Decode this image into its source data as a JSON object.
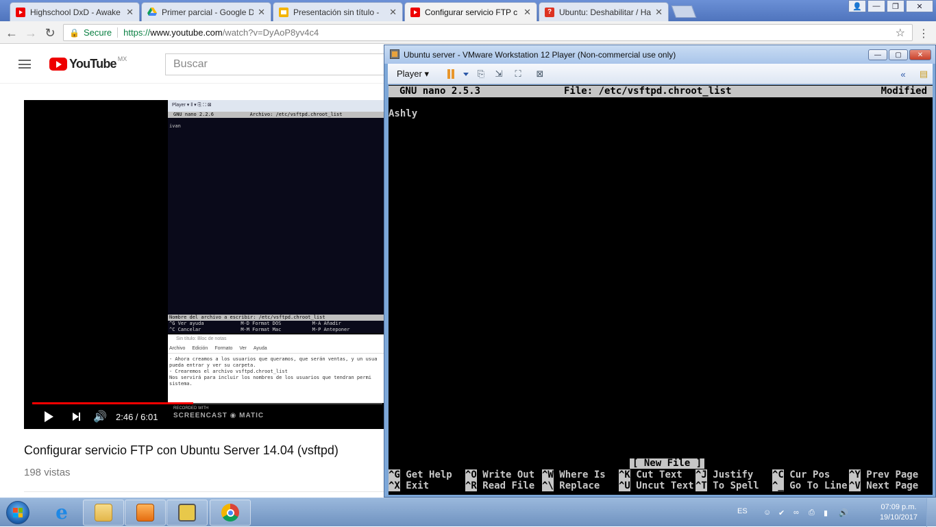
{
  "browser": {
    "tabs": [
      {
        "label": "Highschool DxD - Awake",
        "icon": "youtube-icon"
      },
      {
        "label": "Primer parcial - Google D",
        "icon": "google-drive-icon"
      },
      {
        "label": "Presentación sin título - ",
        "icon": "google-slides-icon"
      },
      {
        "label": "Configurar servicio FTP c",
        "icon": "youtube-icon"
      },
      {
        "label": "Ubuntu: Deshabilitar / Ha",
        "icon": "quora-icon"
      }
    ],
    "address": {
      "secure_label": "Secure",
      "scheme": "https://",
      "host": "www.youtube.com",
      "path": "/watch?v=DyAoP8yv4c4"
    }
  },
  "youtube": {
    "logo_text": "YouTube",
    "region": "MX",
    "search_placeholder": "Buscar",
    "player": {
      "time": "2:46 / 6:01",
      "progress_fraction": 0.46,
      "embedded": {
        "toolbar": "Player ▾  ‖ ▾  ⎘ ⛶ ⊠",
        "nano_title": "GNU nano 2.2.6",
        "nano_file": "Archivo: /etc/vsftpd.chroot_list",
        "nano_text": "ivan",
        "prompt": "Nombre del archivo a escribir: /etc/vsftpd.chroot_list",
        "keys": [
          "^G Ver ayuda",
          "M-D Format DOS",
          "M-A Añadir",
          "^C Cancelar",
          "M-M Format Mac",
          "M-P Anteponer"
        ],
        "notepad_title": "Sin título: Bloc de notas",
        "notepad_menu": [
          "Archivo",
          "Edición",
          "Formato",
          "Ver",
          "Ayuda"
        ],
        "notepad_lines": [
          "- Ahora creamos a los usuarios que queramos, que serán ventas, y un usua",
          "  pueda entrar y ver su carpeta.",
          "",
          "- Crearemos el archivo vsftpd.chroot_list",
          "  Nos servirá para incluir los nombres de los usuarios que tendran permi",
          "  sistema."
        ],
        "badge_small": "RECORDED WITH",
        "badge_brand": "SCREENCAST ◉ MATIC"
      }
    },
    "video_title": "Configurar servicio FTP con Ubuntu Server 14.04 (vsftpd)",
    "views": "198 vistas"
  },
  "vmware": {
    "title": "Ubuntu server - VMware Workstation 12 Player (Non-commercial use only)",
    "player_menu": "Player",
    "nano": {
      "version": "GNU nano 2.5.3",
      "file": "File: /etc/vsftpd.chroot_list",
      "state": "Modified",
      "content": "Ashly",
      "status": "[ New File ]",
      "shortcuts_row1": [
        {
          "key": "^G",
          "label": "Get Help"
        },
        {
          "key": "^O",
          "label": "Write Out"
        },
        {
          "key": "^W",
          "label": "Where Is"
        },
        {
          "key": "^K",
          "label": "Cut Text"
        },
        {
          "key": "^J",
          "label": "Justify"
        },
        {
          "key": "^C",
          "label": "Cur Pos"
        },
        {
          "key": "^Y",
          "label": "Prev Page"
        }
      ],
      "shortcuts_row2": [
        {
          "key": "^X",
          "label": "Exit"
        },
        {
          "key": "^R",
          "label": "Read File"
        },
        {
          "key": "^\\",
          "label": "Replace"
        },
        {
          "key": "^U",
          "label": "Uncut Text"
        },
        {
          "key": "^T",
          "label": "To Spell"
        },
        {
          "key": "^_",
          "label": "Go To Line"
        },
        {
          "key": "^V",
          "label": "Next Page"
        }
      ]
    }
  },
  "taskbar": {
    "language": "ES",
    "time": "07:09 p.m.",
    "date": "19/10/2017"
  }
}
